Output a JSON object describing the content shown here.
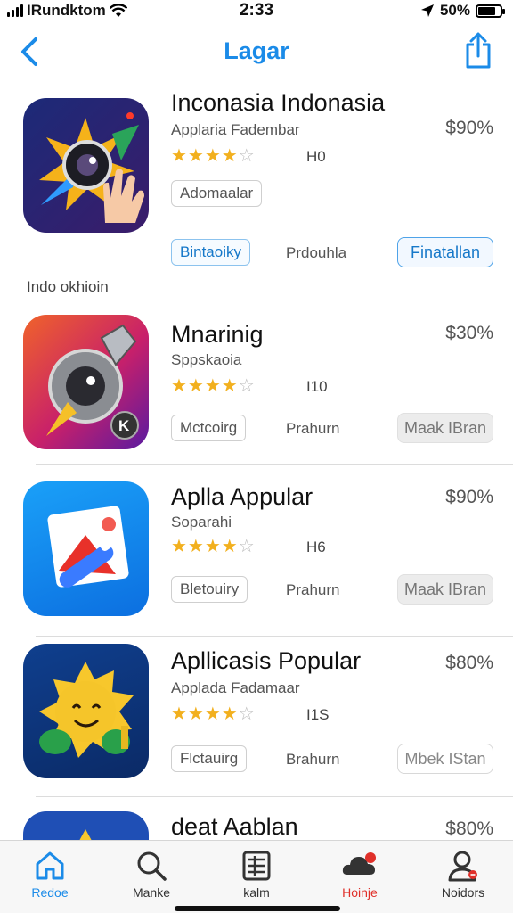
{
  "status": {
    "carrier": "IRundktom",
    "time": "2:33",
    "battery": "50%",
    "battery_level": 0.8
  },
  "nav": {
    "title": "Lagar",
    "back_icon": "chevron-left-icon",
    "share_icon": "share-icon"
  },
  "section_label": "Indo okhioin",
  "apps": [
    {
      "name": "Inconasia Indonasia",
      "developer": "Applaria Fadembar",
      "rating": 4.5,
      "count": "H0",
      "price": "$90%",
      "tag": "Adomaalar",
      "middle": "Prdouhla",
      "action": "Finatallan",
      "tag_style": "blue",
      "action_style": "install"
    },
    {
      "name": "Mnarinig",
      "developer": "Sppskaoia",
      "rating": 4.5,
      "count": "I10",
      "price": "$30%",
      "tag": "Mctcoirg",
      "middle": "Prahurn",
      "action": "Maak IBran",
      "tag_style": "plain",
      "action_style": "gray"
    },
    {
      "name": "Aplla Appular",
      "developer": "Soparahi",
      "rating": 4.5,
      "count": "H6",
      "price": "$90%",
      "tag": "Bletouiry",
      "middle": "Prahurn",
      "action": "Maak IBran",
      "tag_style": "plain",
      "action_style": "gray"
    },
    {
      "name": "Apllicasis Popular",
      "developer": "Applada Fadamaar",
      "rating": 4.5,
      "count": "I1S",
      "price": "$80%",
      "tag": "Flctauirg",
      "middle": "Brahurn",
      "action": "Mbek IStan",
      "tag_style": "plain",
      "action_style": "outline"
    },
    {
      "name": "deat Aablan",
      "price": "$80%"
    }
  ],
  "first_tag": "Bintaoiky",
  "tabs": [
    {
      "label": "Redoe",
      "icon": "home-icon"
    },
    {
      "label": "Manke",
      "icon": "search-icon"
    },
    {
      "label": "kalm",
      "icon": "list-icon"
    },
    {
      "label": "Hoinje",
      "icon": "cloud-notification-icon"
    },
    {
      "label": "Noidors",
      "icon": "person-icon"
    }
  ],
  "colors": {
    "accent": "#1b8be8",
    "star": "#f2b01e",
    "alert": "#e0302a"
  }
}
